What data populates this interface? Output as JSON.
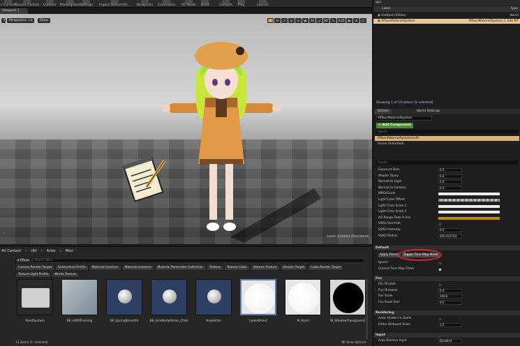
{
  "toolbar": {
    "items": [
      "+ Current",
      "Source Control",
      "Content",
      "Marketplace",
      "Settings",
      "Import Datasmith...",
      "Blueprints",
      "Cinematics",
      "VR Mode",
      "Build",
      "Compile",
      "Play",
      "Launch"
    ]
  },
  "viewport": {
    "tab_title": "Viewport 1",
    "perspective": "Perspective",
    "lit": "Lit",
    "show": "Show",
    "snap_grid": "10",
    "snap_rotation": "10°",
    "snap_scale": "0.25",
    "camera_speed": "4",
    "level_label": "Level:  Untitled (Persistent)"
  },
  "content_browser": {
    "path": [
      "4U Content",
      "Util",
      "Actor",
      "Misc"
    ],
    "filters_label": "Filters",
    "search_placeholder": "Search Misc",
    "tags": [
      "Canvas Render Target",
      "Subsurface Profile",
      "Material Function",
      "Material Instance",
      "Material Parameter Collection",
      "Texture",
      "Texture Cube",
      "Volume Texture",
      "Render Target",
      "Cube Render Target",
      "Texture Light Profile",
      "Media Texture"
    ],
    "assets": [
      {
        "name": "PaintSystem",
        "kind": "folder"
      },
      {
        "name": "BP_HMDTracking",
        "kind": "mesh"
      },
      {
        "name": "BP_SpringBoneUtil",
        "kind": "sphere"
      },
      {
        "name": "BP_VrmModelActor_Child",
        "kind": "sphere"
      },
      {
        "name": "dropActor",
        "kind": "sphere"
      },
      {
        "name": "LookAtPoint",
        "kind": "white",
        "selected": true
      },
      {
        "name": "M_Point",
        "kind": "white"
      },
      {
        "name": "M_WindowTransparent",
        "kind": "black"
      }
    ],
    "footer": "11 items (1 selected)",
    "view_options": "View Options"
  },
  "outliner": {
    "header": "ops",
    "col_label": "Label",
    "col_type": "Type",
    "rows": [
      {
        "label": "Untitled (Editor)",
        "type": "World"
      },
      {
        "label": "MToonMaterialSystem",
        "type": "MToonMaterialSystem_C   Edit MT",
        "selected": true
      }
    ],
    "status": "Showing 1 of 19 actors (1 selected)"
  },
  "details": {
    "tabs": [
      "Details",
      "World Settings"
    ],
    "actor_name": "MToonMaterialSystem",
    "add_component": "+ Add Component",
    "search_components": "Search",
    "components": [
      {
        "label": "MToonMaterialSystem(self)",
        "selected": true
      },
      {
        "label": "Scene (Inherited)",
        "selected": false
      }
    ],
    "search_details": "Search",
    "properties_top": [
      {
        "label": "Exposure Bias",
        "value": "0.0"
      },
      {
        "label": "Shader Toony",
        "value": "0.0"
      },
      {
        "label": "Normal to Light",
        "value": "0.0"
      },
      {
        "label": "Normal to Camera",
        "value": "0.0"
      },
      {
        "label": "MRGAScale",
        "swatch": "#ececec"
      },
      {
        "label": "Light Color Offset",
        "swatch": "checker"
      },
      {
        "label": "Light Color Scale 1",
        "swatch": "#ececec"
      },
      {
        "label": "Light Color Scale 2",
        "swatch": "#ececec"
      },
      {
        "label": "AO Range Fade 0 Use",
        "swatch": "#c08a10"
      },
      {
        "label": "SSAO Override",
        "check": false
      },
      {
        "label": "SSAO Intensity",
        "value": "0.0"
      },
      {
        "label": "SSAO Radius",
        "value": "305.431763"
      }
    ],
    "section_default": "Default",
    "apply_label": "Apply Param",
    "toggle_label": "Toggle Tone Map Mode",
    "properties_default": [
      {
        "label": "Ignore",
        "check": false
      },
      {
        "label": "Current Tone Map Filmic",
        "check": true
      }
    ],
    "section_fov": "Fov",
    "properties_fov": [
      {
        "label": "Fov Disable",
        "check": false
      },
      {
        "label": "Fov Distance",
        "value": "0.0"
      },
      {
        "label": "Fov Scale",
        "value": "100.0"
      },
      {
        "label": "Fov Scale Bias",
        "value": "0.0"
      }
    ],
    "section_rendering": "Rendering",
    "properties_rendering": [
      {
        "label": "Actor Hidden In Game",
        "check": false
      },
      {
        "label": "Editor Billboard Scale",
        "value": "1.0"
      }
    ],
    "section_input": "Input",
    "properties_input": [
      {
        "label": "Auto Receive Input",
        "value": "Disabled"
      }
    ]
  }
}
